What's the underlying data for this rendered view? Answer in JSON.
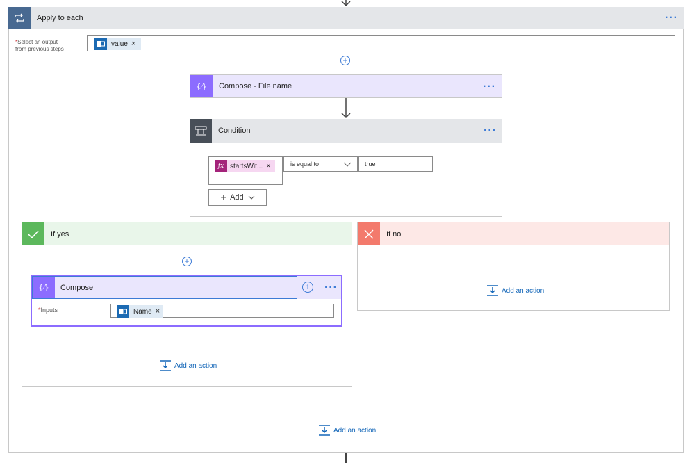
{
  "apply": {
    "title": "Apply to each",
    "select_label_line1": "Select an output",
    "select_label_line2": "from previous steps",
    "required_mark": "*",
    "token": "value",
    "token_remove": "×",
    "more": "···"
  },
  "compose_file": {
    "title": "Compose - File name",
    "more": "···"
  },
  "condition": {
    "title": "Condition",
    "more": "···",
    "expr_token": "startsWit...",
    "expr_remove": "×",
    "fx_symbol": "fx",
    "operator": "is equal to",
    "value": "true",
    "add_label": "Add"
  },
  "if_yes": {
    "title": "If yes",
    "compose": {
      "title": "Compose",
      "more": "···",
      "info_symbol": "i",
      "inputs_label": "Inputs",
      "required_mark": "*",
      "token": "Name",
      "token_remove": "×"
    },
    "add_action": "Add an action"
  },
  "if_no": {
    "title": "If no",
    "add_action": "Add an action"
  },
  "footer": {
    "add_action": "Add an action"
  },
  "colors": {
    "loop_head": "#e4e6e9",
    "loop_icon": "#486991",
    "compose_head": "#eae6fd",
    "compose_icon": "#8c6cff",
    "condition_icon": "#484f58",
    "yes_head": "#e9f6ea",
    "yes_icon": "#5cb85c",
    "no_head": "#fde8e6",
    "no_icon": "#f37a6c",
    "link": "#1366b8",
    "token_bg": "#dfeaf4",
    "token_icon": "#1b6ab3",
    "expr_bg": "#f6d7f1",
    "expr_icon": "#a4237a"
  }
}
